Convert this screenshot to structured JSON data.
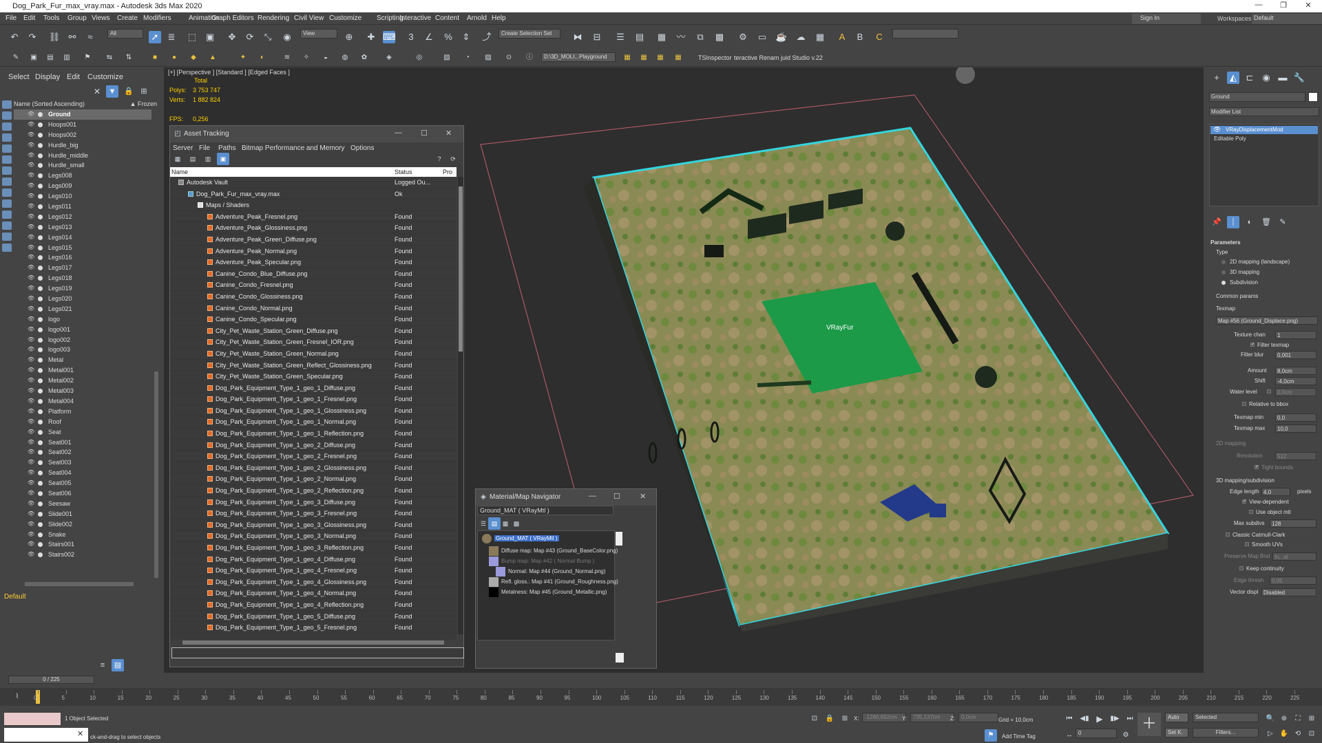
{
  "window": {
    "title": "Dog_Park_Fur_max_vray.max - Autodesk 3ds Max 2020"
  },
  "menu": [
    "File",
    "Edit",
    "Tools",
    "Group",
    "Views",
    "Create",
    "Modifiers",
    "Animation",
    "Graph Editors",
    "Rendering",
    "Civil View",
    "Customize",
    "Scripting",
    "Interactive",
    "Content",
    "Arnold",
    "Help"
  ],
  "account": {
    "sign_in": "Sign In",
    "workspaces_label": "Workspaces:",
    "workspace": "Default"
  },
  "toolbar": {
    "filter": "All",
    "coord": "View",
    "selection_set": "Create Selection Set",
    "path": "D:\\3D_MOLI...Playground",
    "ts_inspector": "TSInspector",
    "renamer": "teractive Renam juid Studio v.22"
  },
  "scene_explorer": {
    "tabs": [
      "Select",
      "Display",
      "Edit",
      "Customize"
    ],
    "header": "Name (Sorted Ascending)",
    "frozen": "▲ Frozen",
    "selected": "Ground",
    "items": [
      "Ground",
      "Hoops001",
      "Hoops002",
      "Hurdle_big",
      "Hurdle_middle",
      "Hurdle_small",
      "Legs008",
      "Legs009",
      "Legs010",
      "Legs011",
      "Legs012",
      "Legs013",
      "Legs014",
      "Legs015",
      "Legs016",
      "Legs017",
      "Legs018",
      "Legs019",
      "Legs020",
      "Legs021",
      "logo",
      "logo001",
      "logo002",
      "logo003",
      "Metal",
      "Metal001",
      "Metal002",
      "Metal003",
      "Metal004",
      "Platform",
      "Roof",
      "Seat",
      "Seat001",
      "Seat002",
      "Seat003",
      "Seat004",
      "Seat005",
      "Seat006",
      "Seesaw",
      "Slide001",
      "Slide002",
      "Snake",
      "Stairs001",
      "Stairs002"
    ],
    "layer": "Default"
  },
  "viewport": {
    "label": "[+] [Perspective ] [Standard ] [Edged Faces ]",
    "total": "Total",
    "polys_label": "Polys:",
    "polys": "3 753 747",
    "verts_label": "Verts:",
    "verts": "1 882 824",
    "fps_label": "FPS:",
    "fps": "0,256",
    "object_label": "VRayFur"
  },
  "asset_tracking": {
    "title": "Asset Tracking",
    "menu": [
      "Server",
      "File",
      "Paths",
      "Bitmap Performance and Memory",
      "Options"
    ],
    "columns": {
      "name": "Name",
      "status": "Status",
      "pro": "Pro"
    },
    "vault": {
      "name": "Autodesk Vault",
      "status": "Logged Ou..."
    },
    "file": {
      "name": "Dog_Park_Fur_max_vray.max",
      "status": "Ok"
    },
    "folder": "Maps / Shaders",
    "found": "Found",
    "maps": [
      "Adventure_Peak_Fresnel.png",
      "Adventure_Peak_Glossiness.png",
      "Adventure_Peak_Green_Diffuse.png",
      "Adventure_Peak_Normal.png",
      "Adventure_Peak_Specular.png",
      "Canine_Condo_Blue_Diffuse.png",
      "Canine_Condo_Fresnel.png",
      "Canine_Condo_Glossiness.png",
      "Canine_Condo_Normal.png",
      "Canine_Condo_Specular.png",
      "City_Pet_Waste_Station_Green_Diffuse.png",
      "City_Pet_Waste_Station_Green_Fresnel_IOR.png",
      "City_Pet_Waste_Station_Green_Normal.png",
      "City_Pet_Waste_Station_Green_Reflect_Glossiness.png",
      "City_Pet_Waste_Station_Green_Specular.png",
      "Dog_Park_Equipment_Type_1_geo_1_Diffuse.png",
      "Dog_Park_Equipment_Type_1_geo_1_Fresnel.png",
      "Dog_Park_Equipment_Type_1_geo_1_Glossiness.png",
      "Dog_Park_Equipment_Type_1_geo_1_Normal.png",
      "Dog_Park_Equipment_Type_1_geo_1_Reflection.png",
      "Dog_Park_Equipment_Type_1_geo_2_Diffuse.png",
      "Dog_Park_Equipment_Type_1_geo_2_Fresnel.png",
      "Dog_Park_Equipment_Type_1_geo_2_Glossiness.png",
      "Dog_Park_Equipment_Type_1_geo_2_Normal.png",
      "Dog_Park_Equipment_Type_1_geo_2_Reflection.png",
      "Dog_Park_Equipment_Type_1_geo_3_Diffuse.png",
      "Dog_Park_Equipment_Type_1_geo_3_Fresnel.png",
      "Dog_Park_Equipment_Type_1_geo_3_Glossiness.png",
      "Dog_Park_Equipment_Type_1_geo_3_Normal.png",
      "Dog_Park_Equipment_Type_1_geo_3_Reflection.png",
      "Dog_Park_Equipment_Type_1_geo_4_Diffuse.png",
      "Dog_Park_Equipment_Type_1_geo_4_Fresnel.png",
      "Dog_Park_Equipment_Type_1_geo_4_Glossiness.png",
      "Dog_Park_Equipment_Type_1_geo_4_Normal.png",
      "Dog_Park_Equipment_Type_1_geo_4_Reflection.png",
      "Dog_Park_Equipment_Type_1_geo_5_Diffuse.png",
      "Dog_Park_Equipment_Type_1_geo_5_Fresnel.png"
    ]
  },
  "material_navigator": {
    "title": "Material/Map Navigator",
    "field": "Ground_MAT  ( VRayMtl )",
    "root": "Ground_MAT  ( VRayMtl )",
    "nodes": [
      {
        "label": "Diffuse map: Map #43 (Ground_BaseColor.png)",
        "dim": false,
        "swatch": "#8a7a5a"
      },
      {
        "label": "Bump map: Map #42  ( Normal Bump )",
        "dim": true,
        "swatch": "#9a9adc"
      },
      {
        "label": "Normal: Map #44 (Ground_Normal.png)",
        "dim": false,
        "swatch": "#9a9adc"
      },
      {
        "label": "Refl. gloss.: Map #41 (Ground_Roughness.png)",
        "dim": false,
        "swatch": "#aaaaaa"
      },
      {
        "label": "Metalness: Map #45 (Ground_Metallic.png)",
        "dim": false,
        "swatch": "#000000"
      }
    ]
  },
  "command_panel": {
    "object_name": "Ground",
    "modifier_list": "Modifier List",
    "stack": [
      "VRayDisplacementMod",
      "Editable Poly"
    ],
    "parameters": "Parameters",
    "type": "Type",
    "types": [
      "2D mapping (landscape)",
      "3D mapping",
      "Subdivision"
    ],
    "common": "Common params",
    "texmap_label": "Texmap",
    "texmap": "Map #56 (Ground_Displace.png)",
    "texture_chan_label": "Texture chan",
    "texture_chan": "1",
    "filter_texmap": "Filter texmap",
    "filter_blur_label": "Filter blur",
    "filter_blur": "0,001",
    "amount_label": "Amount",
    "amount": "8,0cm",
    "shift_label": "Shift",
    "shift": "-4,0cm",
    "water_label": "Water level",
    "water": "0,0cm",
    "relative_bbox": "Relative to bbox",
    "texmap_min_label": "Texmap min",
    "texmap_min": "0,0",
    "texmap_max_label": "Texmap max",
    "texmap_max": "10,0",
    "mapping2d": "2D mapping",
    "resolution_label": "Resolution",
    "resolution": "512",
    "tight_bounds": "Tight bounds",
    "mapping3d": "3D mapping/subdivision",
    "edge_length_label": "Edge length",
    "edge_length": "4,0",
    "pixels": "pixels",
    "view_dependent": "View-dependent",
    "use_object_mtl": "Use object mtl",
    "max_subdivs_label": "Max subdivs",
    "max_subdivs": "128",
    "classic_cc": "Classic Catmull-Clark",
    "smooth_uvs": "Smooth UVs",
    "preserve_label": "Preserve Map Bnd",
    "preserve": "In...al",
    "keep_continuity": "Keep continuity",
    "edge_thresh_label": "Edge thresh",
    "edge_thresh": "0,05",
    "vector_label": "Vector displ",
    "vector": "Disabled"
  },
  "timeline": {
    "frame": "0 / 225",
    "ticks": [
      0,
      5,
      10,
      15,
      20,
      25,
      30,
      35,
      40,
      45,
      50,
      55,
      60,
      65,
      70,
      75,
      80,
      85,
      90,
      95,
      100,
      105,
      110,
      115,
      120,
      125,
      130,
      135,
      140,
      145,
      150,
      155,
      160,
      165,
      170,
      175,
      180,
      185,
      190,
      195,
      200,
      205,
      210,
      215,
      220,
      225
    ],
    "max": 225
  },
  "status": {
    "selected": "1 Object Selected",
    "prompt": "ck-and-drag to select objects",
    "x_label": "X:",
    "x": "-1280,892cm",
    "y_label": "Y:",
    "y": "735,137cm",
    "z_label": "Z:",
    "z": "0,0cm",
    "grid": "Grid = 10,0cm",
    "add_time_tag": "Add Time Tag",
    "auto": "Auto",
    "set_key": "Set K.",
    "selected_dd": "Selected",
    "filters": "Filters...",
    "frame_field": "0"
  }
}
